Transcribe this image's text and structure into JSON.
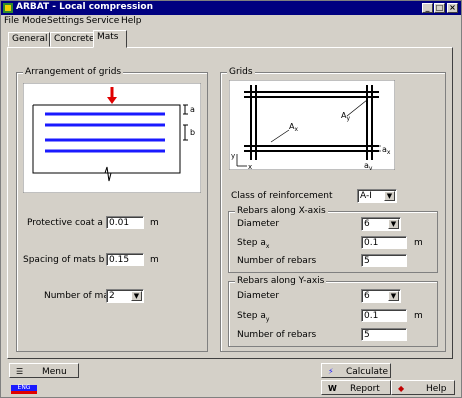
{
  "window": {
    "title": "ARBAT - Local compression"
  },
  "menu": [
    "File",
    "Mode",
    "Settings",
    "Service",
    "Help"
  ],
  "tabs": [
    "General",
    "Concrete",
    "Mats"
  ],
  "left_group": {
    "title": "Arrangement of grids",
    "dim_a": "a",
    "dim_b": "b",
    "protective_coat_label": "Protective coat a =",
    "protective_coat_value": "0.01",
    "protective_coat_unit": "m",
    "spacing_label": "Spacing of mats b =",
    "spacing_value": "0.15",
    "spacing_unit": "m",
    "number_label": "Number of mats",
    "number_value": "2"
  },
  "right_group": {
    "title": "Grids",
    "diagram": {
      "ax": "A",
      "ax_sub": "x",
      "ay": "A",
      "ay_sub": "y",
      "axis_y": "y",
      "axis_x": "x",
      "step_ax": "a",
      "step_ax_sub": "x",
      "step_ay": "a",
      "step_ay_sub": "y"
    },
    "class_label": "Class of reinforcement",
    "class_value": "A-I",
    "x_group": {
      "title": "Rebars along X-axis",
      "diameter_label": "Diameter",
      "diameter_value": "6",
      "step_label": "Step a",
      "step_sub": "x",
      "step_value": "0.1",
      "step_unit": "m",
      "num_label": "Number of rebars",
      "num_value": "5"
    },
    "y_group": {
      "title": "Rebars along Y-axis",
      "diameter_label": "Diameter",
      "diameter_value": "6",
      "step_label": "Step a",
      "step_sub": "y",
      "step_value": "0.1",
      "step_unit": "m",
      "num_label": "Number of rebars",
      "num_value": "5"
    }
  },
  "bottom": {
    "menu_label": "Menu",
    "calculate_label": "Calculate",
    "report_label": "Report",
    "help_label": "Help",
    "status_badge": "ENG"
  },
  "colors": {
    "titlebar": "#000080",
    "rebar": "#1a1aff",
    "arrow": "#e00000",
    "window": "#d4d0c8"
  }
}
